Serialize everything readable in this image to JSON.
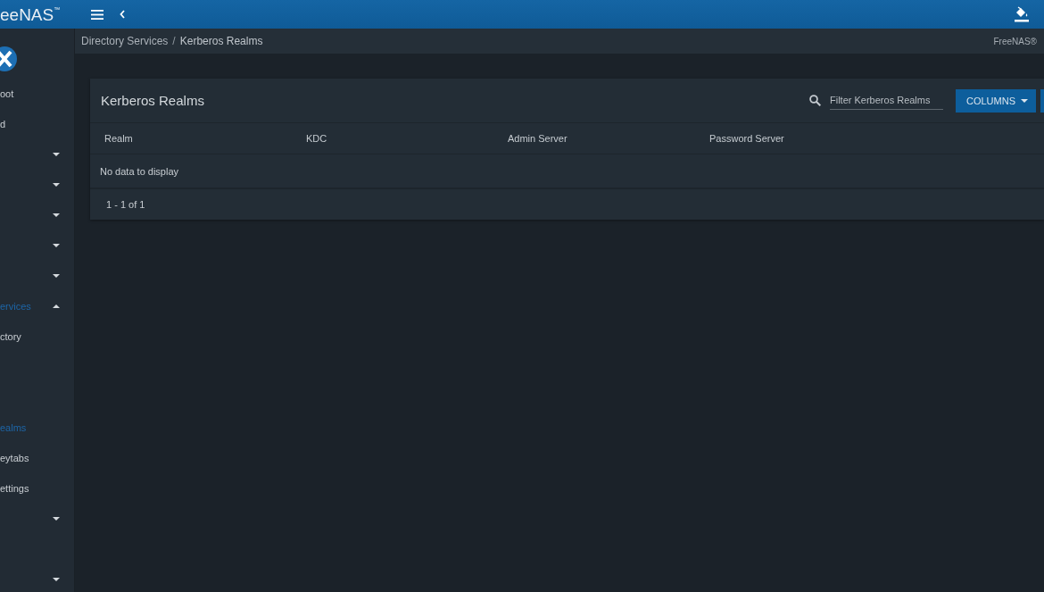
{
  "topbar": {
    "brand": "eeNAS$^{™}$"
  },
  "sidebar": {
    "items": [
      {
        "kind": "link",
        "label": "oot",
        "selected": false
      },
      {
        "kind": "link",
        "label": "d",
        "selected": false
      },
      {
        "kind": "group",
        "expanded": false
      },
      {
        "kind": "group",
        "expanded": false
      },
      {
        "kind": "group",
        "expanded": false
      },
      {
        "kind": "group",
        "expanded": false
      },
      {
        "kind": "group",
        "expanded": false
      },
      {
        "kind": "group",
        "label": "ervices",
        "expanded": true,
        "selected": true,
        "children": [
          {
            "kind": "link",
            "label": "ctory",
            "selected": false
          },
          {
            "kind": "blank"
          },
          {
            "kind": "blank"
          },
          {
            "kind": "link",
            "label": "ealms",
            "selected": true
          },
          {
            "kind": "link",
            "label": "eytabs",
            "selected": false
          },
          {
            "kind": "link",
            "label": "ettings",
            "selected": false
          }
        ]
      },
      {
        "kind": "group",
        "expanded": false
      },
      {
        "kind": "blank"
      },
      {
        "kind": "group",
        "expanded": false
      }
    ]
  },
  "breadcrumb": {
    "items": [
      "Directory Services",
      "Kerberos Realms"
    ],
    "separator": "/",
    "copyright": "FreeNAS®"
  },
  "card": {
    "title": "Kerberos Realms",
    "search": {
      "placeholder": "Filter Kerberos Realms"
    },
    "columns_button": "COLUMNS",
    "table": {
      "columns": [
        "Realm",
        "KDC",
        "Admin Server",
        "Password Server"
      ],
      "empty_message": "No data to display",
      "paginator": "1 - 1 of 1"
    }
  }
}
